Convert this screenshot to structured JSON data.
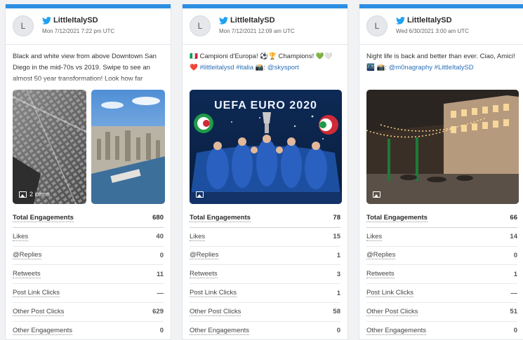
{
  "cards": [
    {
      "avatar": "L",
      "name": "LittleItalySD",
      "date": "Mon 7/12/2021 7:22 pm UTC",
      "text": "Black and white view from above Downtown San Diego in the mid-70s vs 2019. Swipe to see an almost 50 year transformation! Look how far",
      "media_badge": "2 items",
      "metrics": [
        {
          "label": "Total Engagements",
          "value": "680"
        },
        {
          "label": "Likes",
          "value": "40"
        },
        {
          "label": "@Replies",
          "value": "0"
        },
        {
          "label": "Retweets",
          "value": "11"
        },
        {
          "label": "Post Link Clicks",
          "value": "—"
        },
        {
          "label": "Other Post Clicks",
          "value": "629"
        },
        {
          "label": "Other Engagements",
          "value": "0"
        }
      ]
    },
    {
      "avatar": "L",
      "name": "LittleItalySD",
      "date": "Mon 7/12/2021 12:09 am UTC",
      "text_parts": [
        "🇮🇹 Campioni d'Europa! ⚽🏆 Champions! 💚🤍❤️ ",
        "#littleitalysd #italia",
        " 📸: ",
        "@skysport"
      ],
      "banner": "UEFA EURO 2020",
      "metrics": [
        {
          "label": "Total Engagements",
          "value": "78"
        },
        {
          "label": "Likes",
          "value": "15"
        },
        {
          "label": "@Replies",
          "value": "1"
        },
        {
          "label": "Retweets",
          "value": "3"
        },
        {
          "label": "Post Link Clicks",
          "value": "1"
        },
        {
          "label": "Other Post Clicks",
          "value": "58"
        },
        {
          "label": "Other Engagements",
          "value": "0"
        }
      ]
    },
    {
      "avatar": "L",
      "name": "LittleItalySD",
      "date": "Wed 6/30/2021 3:00 am UTC",
      "text_parts": [
        "Night life is back and better than ever. Ciao, Amici! 🌃 📸: ",
        "@m0nagraphy #LittleItalySD"
      ],
      "metrics": [
        {
          "label": "Total Engagements",
          "value": "66"
        },
        {
          "label": "Likes",
          "value": "14"
        },
        {
          "label": "@Replies",
          "value": "0"
        },
        {
          "label": "Retweets",
          "value": "1"
        },
        {
          "label": "Post Link Clicks",
          "value": "—"
        },
        {
          "label": "Other Post Clicks",
          "value": "51"
        },
        {
          "label": "Other Engagements",
          "value": "0"
        }
      ]
    }
  ],
  "colors": {
    "accent": "#2d8fe2",
    "twitter": "#1da1f2",
    "link": "#2b6fb8"
  }
}
